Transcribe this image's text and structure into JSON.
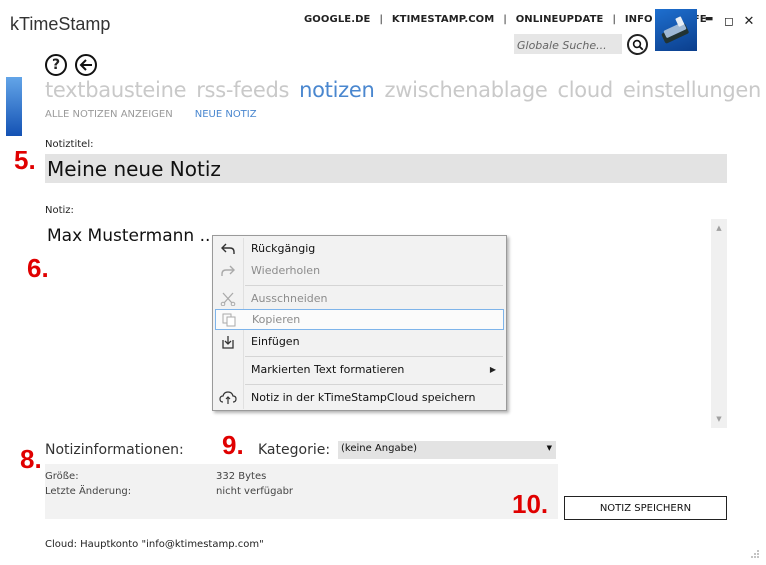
{
  "app": {
    "title": "kTimeStamp"
  },
  "toplinks": [
    "GOOGLE.DE",
    "KTIMESTAMP.COM",
    "ONLINEUPDATE",
    "INFO",
    "HILFE"
  ],
  "search": {
    "placeholder": "Globale Suche...",
    "value": ""
  },
  "window_controls": {
    "minimize": "▬",
    "maximize": "◻",
    "close": "✕"
  },
  "main_nav": {
    "tabs": [
      {
        "label": "textbausteine",
        "active": false
      },
      {
        "label": "rss-feeds",
        "active": false
      },
      {
        "label": "notizen",
        "active": true
      },
      {
        "label": "zwischenablage",
        "active": false
      },
      {
        "label": "cloud",
        "active": false
      },
      {
        "label": "einstellungen",
        "active": false
      }
    ]
  },
  "sub_nav": {
    "items": [
      {
        "label": "ALLE NOTIZEN ANZEIGEN",
        "active": false
      },
      {
        "label": "NEUE NOTIZ",
        "active": true
      }
    ]
  },
  "markers": {
    "m5": "5.",
    "m6": "6.",
    "m8": "8.",
    "m9": "9.",
    "m10": "10."
  },
  "form": {
    "title_label": "Notiztitel:",
    "title_value": "Meine neue Notiz",
    "note_label": "Notiz:",
    "note_value": "Max Mustermann ..."
  },
  "context_menu": {
    "items": [
      {
        "label": "Rückgängig",
        "icon": "undo-icon",
        "disabled": false
      },
      {
        "label": "Wiederholen",
        "icon": "redo-icon",
        "disabled": true
      },
      {
        "label": "Ausschneiden",
        "icon": "cut-icon",
        "disabled": true
      },
      {
        "label": "Kopieren",
        "icon": "copy-icon",
        "disabled": true,
        "hover": true
      },
      {
        "label": "Einfügen",
        "icon": "paste-icon",
        "disabled": false
      },
      {
        "label": "Markierten Text formatieren",
        "icon": "",
        "disabled": false,
        "submenu": true
      },
      {
        "label": "Notiz in der kTimeStampCloud speichern",
        "icon": "cloud-upload-icon",
        "disabled": false
      }
    ]
  },
  "info": {
    "title": "Notizinformationen:",
    "kategorie_label": "Kategorie:",
    "kategorie_value": "(keine Angabe)",
    "rows": [
      {
        "key": "Größe:",
        "value": "332 Bytes"
      },
      {
        "key": "Letzte Änderung:",
        "value": "nicht verfügabr"
      }
    ]
  },
  "save_button": {
    "label": "NOTIZ SPEICHERN"
  },
  "footer": {
    "cloud_text": "Cloud: Hauptkonto \"info@ktimestamp.com\""
  },
  "colors": {
    "accent": "#4a87cf",
    "marker": "#e00000",
    "inactive_tab": "#c9c9c9",
    "field_bg": "#e3e3e3"
  }
}
